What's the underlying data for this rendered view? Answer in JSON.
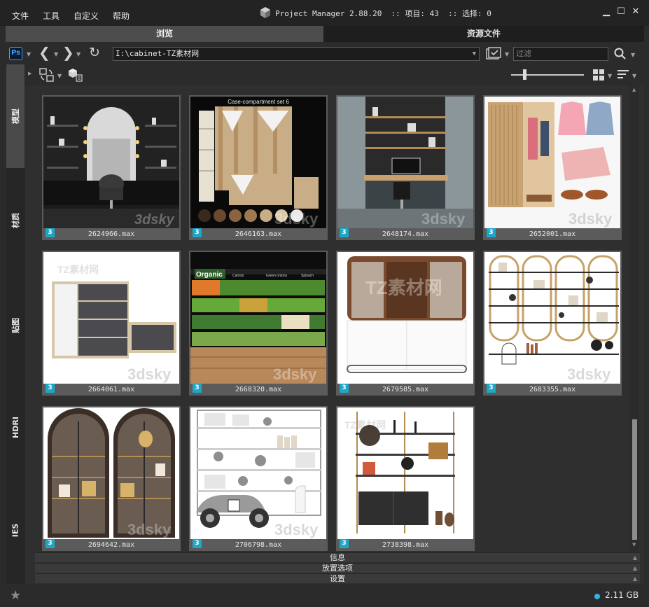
{
  "menu": {
    "file": "文件",
    "tools": "工具",
    "customize": "自定义",
    "help": "帮助"
  },
  "app_title": "Project Manager 2.88.20  :: 项目: 43  :: 选择: 0",
  "tabs": {
    "browse": "浏览",
    "assets": "资源文件"
  },
  "toolbar": {
    "ps_label": "Ps",
    "path": "I:\\cabinet-TZ素材网",
    "filter_placeholder": "过滤"
  },
  "sidetabs": [
    "模型",
    "材质",
    "贴图",
    "HDRI",
    "IES"
  ],
  "items": [
    {
      "name": "2624966.max",
      "badge": "3",
      "scene": "dark-vanity"
    },
    {
      "name": "2646163.max",
      "badge": "3",
      "scene": "case-compartment",
      "title_text": "Case-compartment set 6"
    },
    {
      "name": "2648174.max",
      "badge": "3",
      "scene": "home-office"
    },
    {
      "name": "2652001.max",
      "badge": "3",
      "scene": "wardrobe-clothes"
    },
    {
      "name": "2664061.max",
      "badge": "3",
      "scene": "white-cabinet"
    },
    {
      "name": "2668320.max",
      "badge": "3",
      "scene": "produce-shelf",
      "title_text": "Organic",
      "shelf_labels": [
        "Carrots",
        "Green onions",
        "Spinach"
      ]
    },
    {
      "name": "2679585.max",
      "badge": "3",
      "scene": "oval-cabinet"
    },
    {
      "name": "2683355.max",
      "badge": "3",
      "scene": "gold-shelves"
    },
    {
      "name": "2694642.max",
      "badge": "3",
      "scene": "arched-cabinets"
    },
    {
      "name": "2706798.max",
      "badge": "3",
      "scene": "toy-shelves"
    },
    {
      "name": "2738398.max",
      "badge": "3",
      "scene": "console-shelf"
    }
  ],
  "panels": {
    "info": "信息",
    "placement": "放置选项",
    "settings": "设置"
  },
  "status": {
    "disk": "2.11 GB"
  },
  "colors": {
    "accent": "#1ea7c9",
    "status_dot": "#2fb3e8",
    "active_tab": "#4d4d4d"
  }
}
